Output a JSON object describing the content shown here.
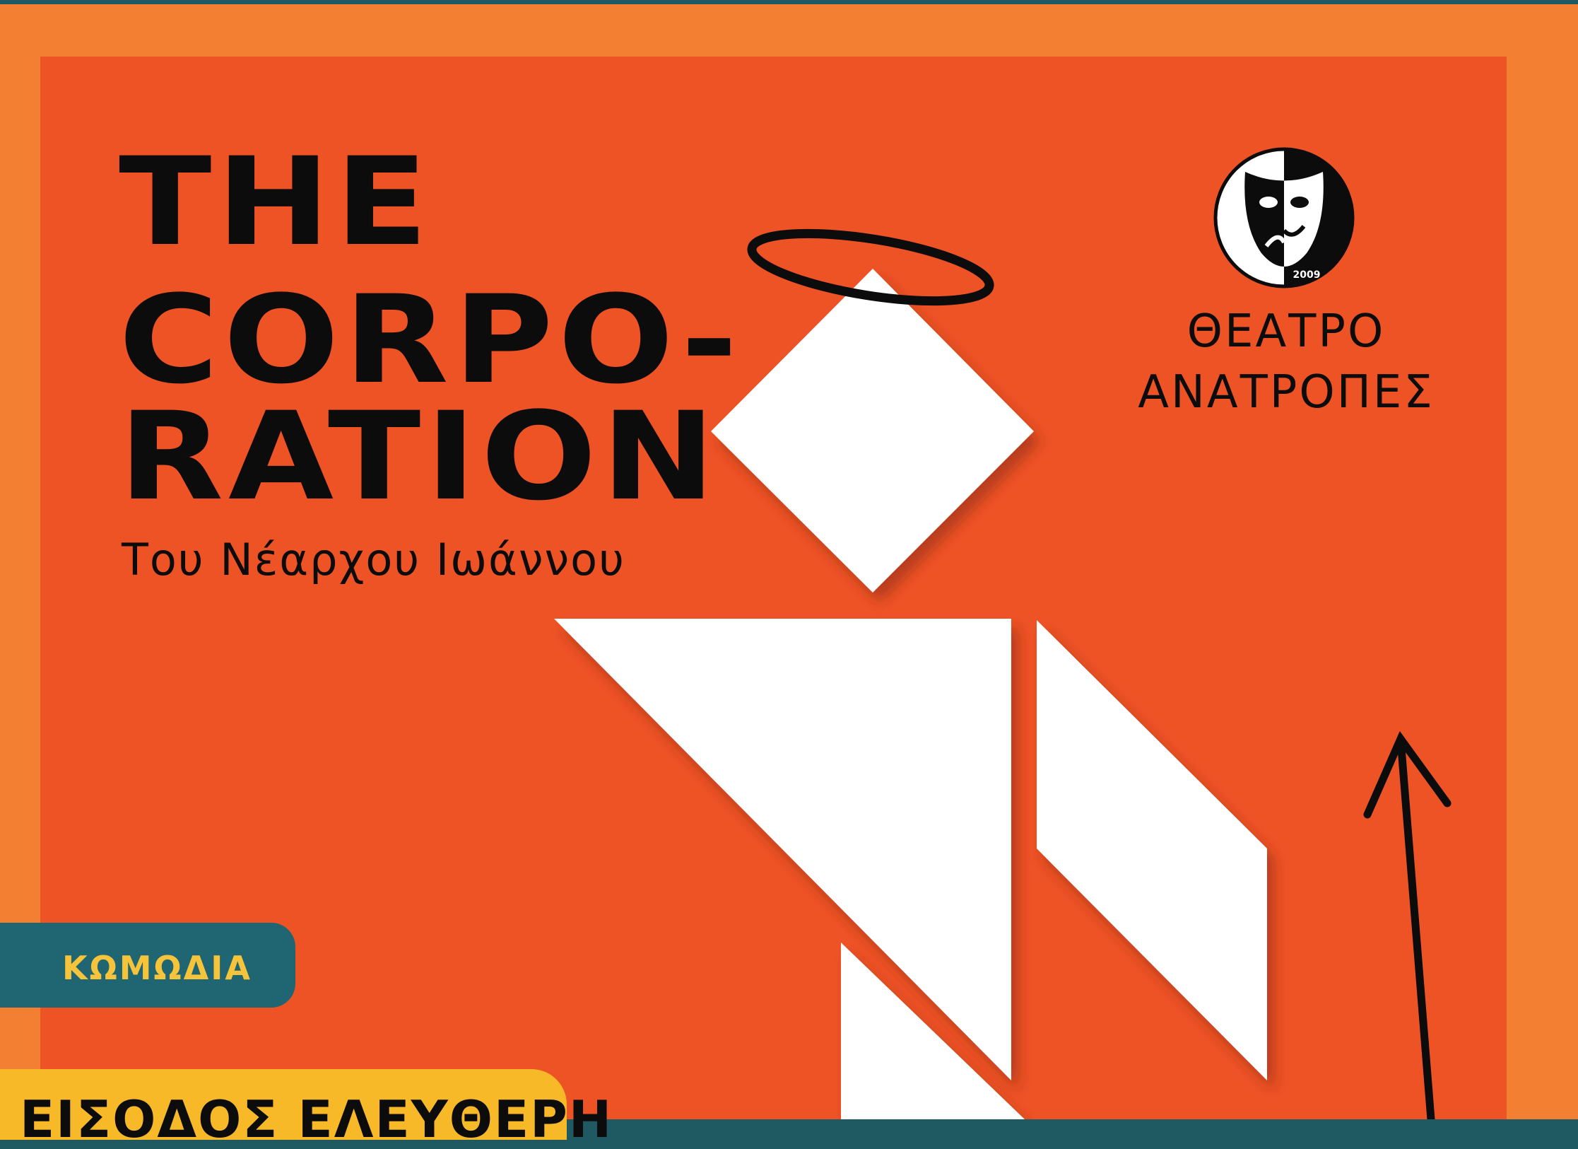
{
  "poster": {
    "title_lines": [
      "THE",
      "CORPO-",
      "RATION"
    ],
    "subtitle": "Του Νέαρχου Ιωάννου",
    "theatre": {
      "name_line1": "ΘΕΑΤΡΟ",
      "name_line2": "ΑΝΑΤΡΟΠΕΣ",
      "logo_year": "2009"
    },
    "genre_badge": "ΚΩΜΩΔΙΑ",
    "entry_banner": "ΕΙΣΟΔΟΣ ΕΛΕΥΘΕΡΗ",
    "colors": {
      "background_teal": "#1f5a63",
      "frame_orange": "#f27f32",
      "panel_red_orange": "#ee5326",
      "badge_teal": "#1f6572",
      "badge_text_yellow": "#f6c43b",
      "banner_yellow": "#f7b928",
      "ink": "#0c0c0c",
      "shape_white": "#ffffff"
    },
    "icons": [
      "theatre-masks-logo-icon",
      "halo-icon",
      "arrow-up-icon"
    ]
  }
}
